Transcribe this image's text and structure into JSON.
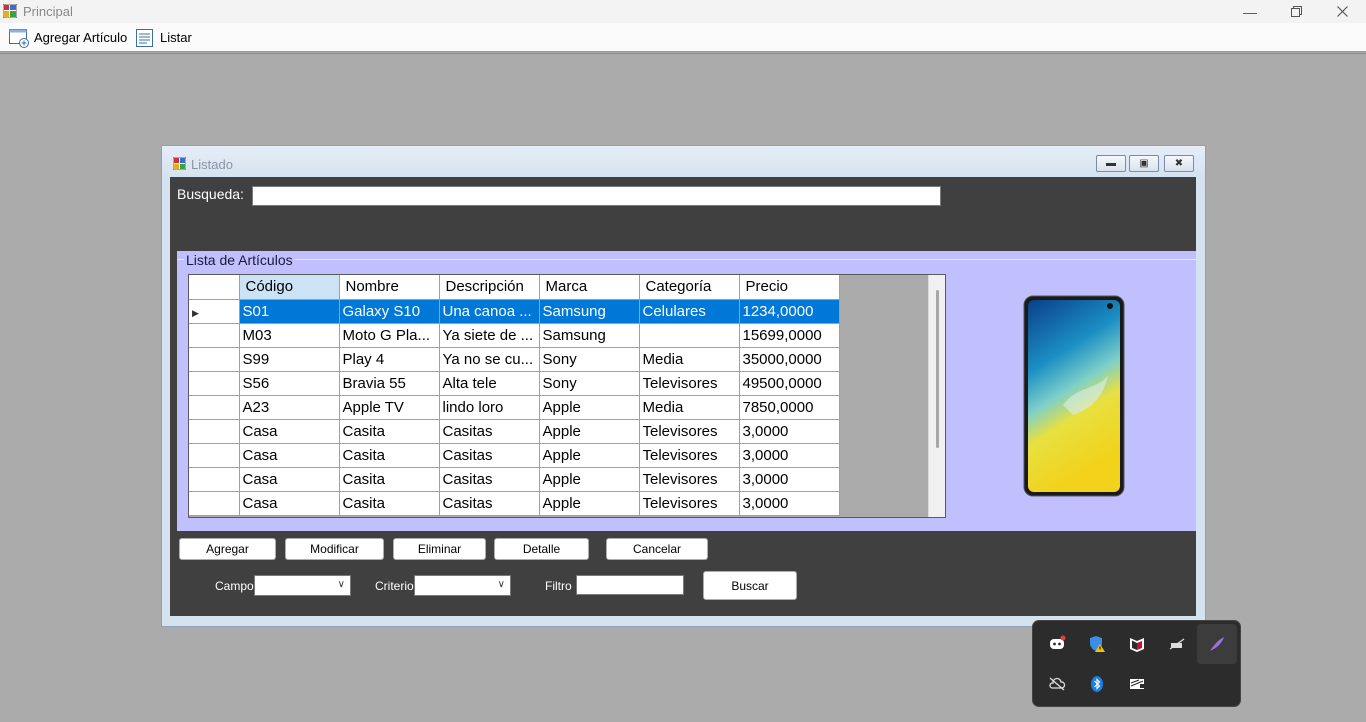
{
  "main_window": {
    "title": "Principal",
    "menu": [
      {
        "label": "Agregar Artículo",
        "icon": "add-form-icon"
      },
      {
        "label": "Listar",
        "icon": "list-icon"
      }
    ]
  },
  "child_window": {
    "title": "Listado",
    "search_label": "Busqueda:",
    "search_value": "",
    "group_title": "Lista de Artículos",
    "grid": {
      "columns": [
        "Código",
        "Nombre",
        "Descripción",
        "Marca",
        "Categoría",
        "Precio"
      ],
      "selected_row_index": 0,
      "rows": [
        [
          "S01",
          "Galaxy S10",
          "Una canoa ...",
          "Samsung",
          "Celulares",
          "1234,0000"
        ],
        [
          "M03",
          "Moto G Pla...",
          "Ya siete de ...",
          "Samsung",
          "",
          "15699,0000"
        ],
        [
          "S99",
          "Play 4",
          "Ya no se cu...",
          "Sony",
          "Media",
          "35000,0000"
        ],
        [
          "S56",
          "Bravia 55",
          "Alta tele",
          "Sony",
          "Televisores",
          "49500,0000"
        ],
        [
          "A23",
          "Apple TV",
          "lindo loro",
          "Apple",
          "Media",
          "7850,0000"
        ],
        [
          "Casa",
          "Casita",
          "Casitas",
          "Apple",
          "Televisores",
          "3,0000"
        ],
        [
          "Casa",
          "Casita",
          "Casitas",
          "Apple",
          "Televisores",
          "3,0000"
        ],
        [
          "Casa",
          "Casita",
          "Casitas",
          "Apple",
          "Televisores",
          "3,0000"
        ],
        [
          "Casa",
          "Casita",
          "Casitas",
          "Apple",
          "Televisores",
          "3,0000"
        ]
      ]
    },
    "buttons": {
      "agregar": "Agregar",
      "modificar": "Modificar",
      "eliminar": "Eliminar",
      "detalle": "Detalle",
      "cancelar": "Cancelar",
      "buscar": "Buscar"
    },
    "filters": {
      "campo_label": "Campo",
      "campo_value": "",
      "criterio_label": "Criterio",
      "criterio_value": "",
      "filtro_label": "Filtro",
      "filtro_value": ""
    }
  },
  "tray_icons": [
    "discord-icon",
    "shield-warning-icon",
    "mcafee-icon",
    "wifi-off-icon",
    "feather-pen-icon",
    "cloud-off-icon",
    "bluetooth-icon",
    "nvidia-icon"
  ]
}
